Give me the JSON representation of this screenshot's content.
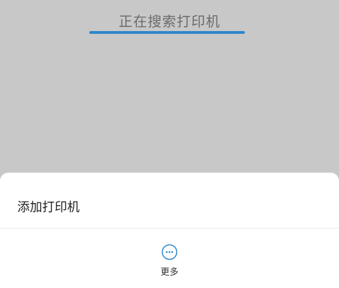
{
  "status": {
    "text": "正在搜索打印机",
    "progress": 1.0
  },
  "sheet": {
    "add_printer_label": "添加打印机",
    "more": {
      "label": "更多",
      "icon": "more-horizontal-circle-icon"
    }
  },
  "colors": {
    "accent": "#2f86c9",
    "overlay_bg": "#c8c8c8",
    "sheet_bg": "#ffffff"
  }
}
